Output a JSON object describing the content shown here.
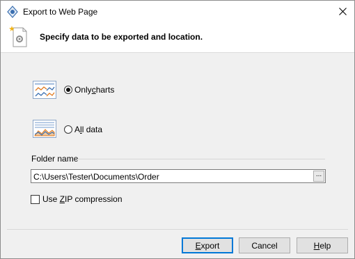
{
  "window": {
    "title": "Export to Web Page"
  },
  "header": {
    "text": "Specify data to be exported and location."
  },
  "options": [
    {
      "pre": "Only",
      "mnemonic": "c",
      "post": "harts",
      "checked": true,
      "icon": "charts-only-icon"
    },
    {
      "pre": "A",
      "mnemonic": "l",
      "post": "l data",
      "checked": false,
      "icon": "all-data-icon"
    }
  ],
  "folder": {
    "label": "Folder name",
    "value": "C:\\Users\\Tester\\Documents\\Order",
    "browse_label": "..."
  },
  "zip": {
    "pre": "Use ",
    "mnemonic": "Z",
    "post": "IP compression",
    "checked": false
  },
  "buttons": {
    "export": {
      "mnemonic": "E",
      "rest": "xport"
    },
    "cancel": {
      "label": "Cancel"
    },
    "help": {
      "mnemonic": "H",
      "rest": "elp"
    }
  },
  "colors": {
    "accent": "#0078d7",
    "chart_orange": "#e07a1f",
    "chart_blue": "#3a6fb0"
  }
}
